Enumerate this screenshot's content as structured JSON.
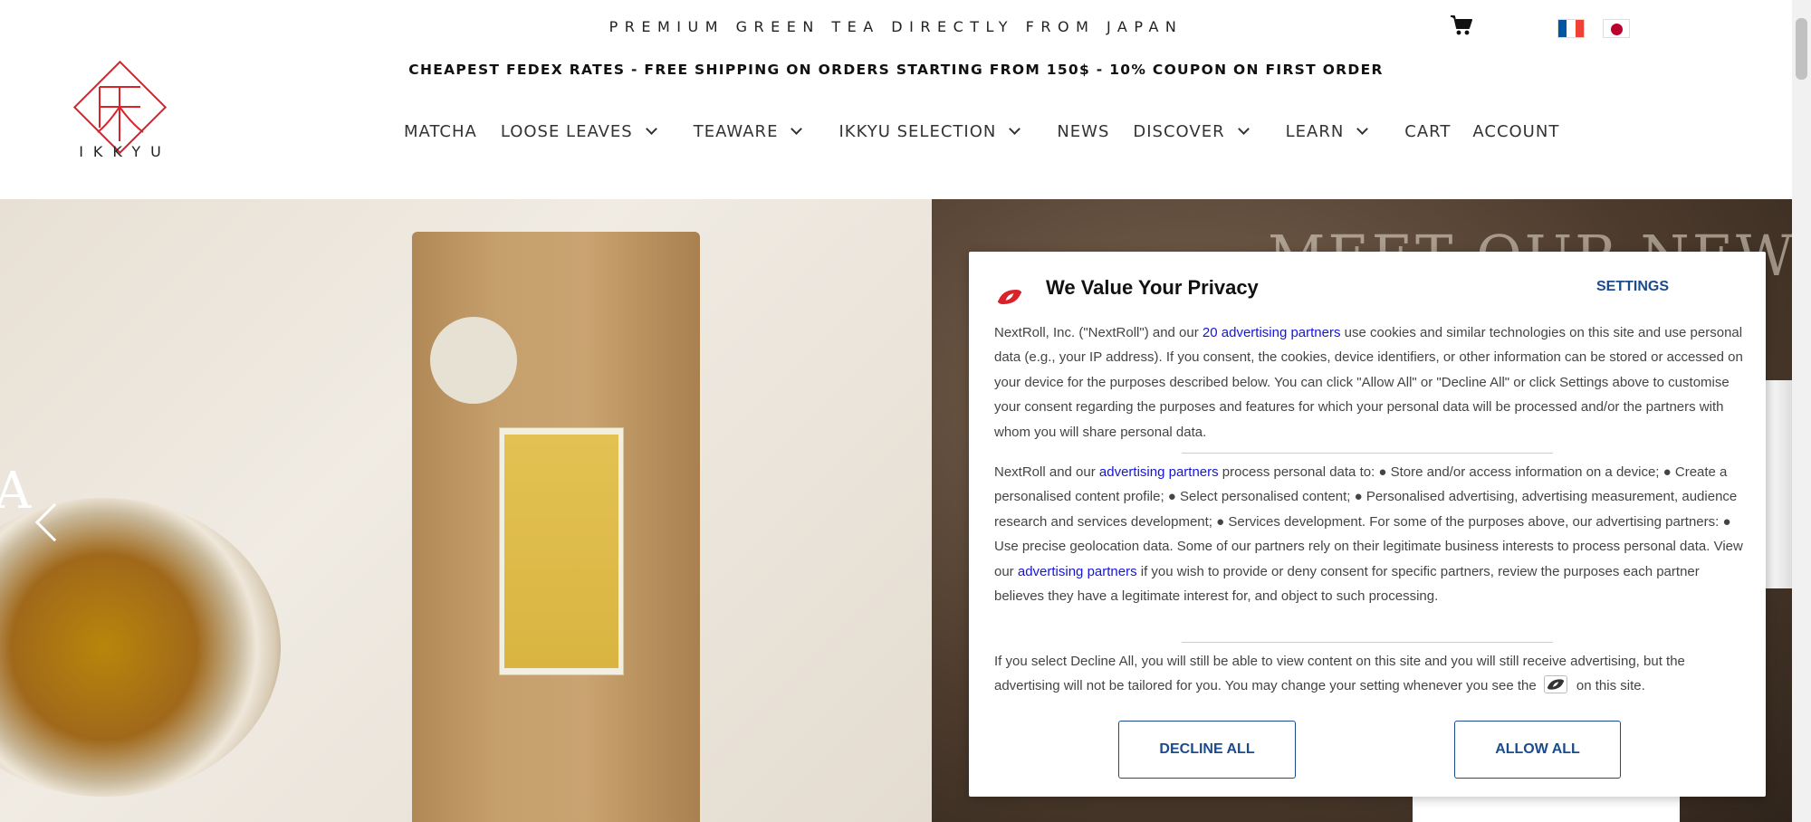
{
  "header": {
    "tagline": "PREMIUM GREEN TEA DIRECTLY FROM JAPAN",
    "promo": "CHEAPEST FEDEX RATES - FREE SHIPPING ON ORDERS STARTING FROM 150$ - 10% COUPON ON FIRST ORDER",
    "logo_text": "IKKYU",
    "cart_icon": "shopping-cart-icon",
    "languages": [
      {
        "code": "fr",
        "icon": "france-flag-icon"
      },
      {
        "code": "ja",
        "icon": "japan-flag-icon"
      }
    ]
  },
  "nav": {
    "items": [
      {
        "label": "MATCHA",
        "has_dropdown": false
      },
      {
        "label": "LOOSE LEAVES",
        "has_dropdown": true
      },
      {
        "label": "TEAWARE",
        "has_dropdown": true
      },
      {
        "label": "IKKYU SELECTION",
        "has_dropdown": true
      },
      {
        "label": "NEWS",
        "has_dropdown": false
      },
      {
        "label": "DISCOVER",
        "has_dropdown": true
      },
      {
        "label": "LEARN",
        "has_dropdown": true
      },
      {
        "label": "CART",
        "has_dropdown": false
      },
      {
        "label": "ACCOUNT",
        "has_dropdown": false
      }
    ]
  },
  "hero": {
    "heading": "MEET OUR NEW",
    "left_char": "A",
    "prev_icon": "chevron-left-icon"
  },
  "consent": {
    "title": "We Value Your Privacy",
    "settings_label": "SETTINGS",
    "p1": {
      "before": "NextRoll, Inc. (\"NextRoll\") and our ",
      "link": "20 advertising partners",
      "after": " use cookies and similar technologies on this site and use personal data (e.g., your IP address). If you consent, the cookies, device identifiers, or other information can be stored or accessed on your device for the purposes described below. You can click \"Allow All\" or \"Decline All\" or click Settings above to customise your consent regarding the purposes and features for which your personal data will be processed and/or the partners with whom you will share personal data."
    },
    "p2": {
      "before": "NextRoll and our ",
      "link1": "advertising partners",
      "middle": " process personal data to: ● Store and/or access information on a device; ● Create a personalised content profile; ● Select personalised content; ● Personalised advertising, advertising measurement, audience research and services development; ● Services development. For some of the purposes above, our advertising partners: ● Use precise geolocation data. Some of our partners rely on their legitimate business interests to process personal data. View our ",
      "link2": "advertising partners",
      "after": " if you wish to provide or deny consent for specific partners, review the purposes each partner believes they have a legitimate interest for, and object to such processing."
    },
    "p3": {
      "before": "If you select Decline All, you will still be able to view content on this site and you will still receive advertising, but the advertising will not be tailored for you. You may change your setting whenever you see the ",
      "after": "on this site."
    },
    "decline_label": "DECLINE ALL",
    "allow_label": "ALLOW ALL",
    "logo_icon": "nextroll-logo-icon"
  },
  "colors": {
    "brand_red": "#d9222a",
    "consent_blue": "#1a4b8c",
    "link_blue": "#1515d8"
  }
}
